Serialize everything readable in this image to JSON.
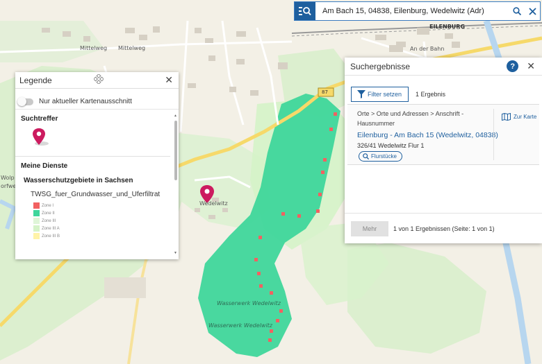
{
  "search": {
    "value": "Am Bach 15, 04838, Eilenburg, Wedelwitz (Adr)",
    "mode_icon": "search-list-icon",
    "search_icon": "magnifier-icon",
    "clear_icon": "close-icon"
  },
  "map": {
    "labels": {
      "mittelweg_1": "Mittelweg",
      "mittelweg_2": "Mittelweg",
      "eilenburg_station": "EILENBURG",
      "an_der_bahn": "An der Bahn",
      "route_87": "87",
      "wedelwitz": "Wedelwitz",
      "wasserwerk_1": "Wasserwerk Wedelwitz",
      "wasserwerk_2": "Wasserwerk Wedelwitz",
      "wolp": "Wolp",
      "orfwe": "orfwe"
    },
    "colors": {
      "zone_ii": "#3fd69b",
      "zone_i": "#f26161",
      "zone_iii": "#d5f3c8",
      "zone_iiib": "#fff3a8"
    }
  },
  "legend": {
    "title": "Legende",
    "toggle_label": "Nur aktueller Kartenausschnitt",
    "section_hits": "Suchtreffer",
    "section_services": "Meine Dienste",
    "group_title": "Wasserschutzgebiete in Sachsen",
    "layer_name": "TWSG_fuer_Grundwasser_und_Uferfiltrat",
    "zones": [
      {
        "label": "Zone I",
        "color": "#f26161"
      },
      {
        "label": "Zone II",
        "color": "#3fd69b"
      },
      {
        "label": "Zone III",
        "color": "#dff5d8"
      },
      {
        "label": "Zone III A",
        "color": "#d5f3c8"
      },
      {
        "label": "Zone III B",
        "color": "#fff3a8"
      }
    ]
  },
  "results": {
    "title": "Suchergebnisse",
    "help_label": "?",
    "filter_label": "Filter setzen",
    "count_label": "1 Ergebnis",
    "items": [
      {
        "category": "Orte > Orte und Adressen > Anschrift - Hausnummer",
        "title": "Eilenburg - Am Bach 15 (Wedelwitz, 04838)",
        "subtitle": "326/41 Wedelwitz Flur 1",
        "parcels_label": "Flurstücke",
        "map_label": "Zur Karte"
      }
    ],
    "more_label": "Mehr",
    "page_info": "1 von 1 Ergebnissen (Seite: 1 von 1)"
  }
}
